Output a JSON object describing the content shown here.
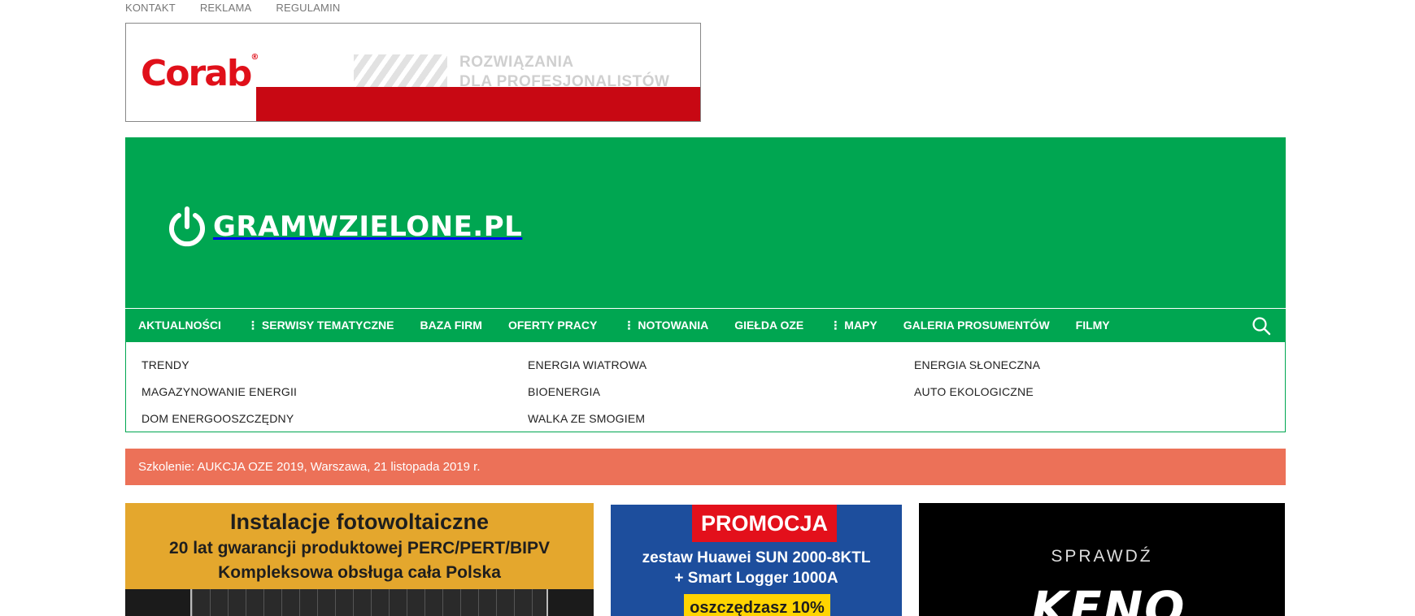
{
  "top_links": [
    "KONTAKT",
    "REKLAMA",
    "REGULAMIN"
  ],
  "ad_banner": {
    "logo_text": "Corab",
    "logo_mark": "®",
    "slogan_line1": "ROZWIĄZANIA",
    "slogan_line2": "DLA PROFESJONALISTÓW",
    "brand_color": "#c80813"
  },
  "header": {
    "site_name": "GRAMWZIELONE.PL",
    "logo_icon": "power-icon",
    "brand_color": "#00a651"
  },
  "nav": {
    "items": [
      {
        "label": "AKTUALNOŚCI",
        "has_submenu": false
      },
      {
        "label": "SERWISY TEMATYCZNE",
        "has_submenu": true
      },
      {
        "label": "BAZA FIRM",
        "has_submenu": false
      },
      {
        "label": "OFERTY PRACY",
        "has_submenu": false
      },
      {
        "label": "NOTOWANIA",
        "has_submenu": true
      },
      {
        "label": "GIEŁDA OZE",
        "has_submenu": false
      },
      {
        "label": "MAPY",
        "has_submenu": true
      },
      {
        "label": "GALERIA PROSUMENTÓW",
        "has_submenu": false
      },
      {
        "label": "FILMY",
        "has_submenu": false
      }
    ],
    "submenu_marker": "⋮",
    "search_icon": "search-icon"
  },
  "submenu": {
    "col1": [
      "TRENDY",
      "MAGAZYNOWANIE ENERGII",
      "DOM ENERGOOSZCZĘDNY"
    ],
    "col2": [
      "ENERGIA WIATROWA",
      "BIOENERGIA",
      "WALKA ZE SMOGIEM"
    ],
    "col3": [
      "ENERGIA SŁONECZNA",
      "AUTO EKOLOGICZNE"
    ]
  },
  "alert": {
    "text": "Szkolenie: AUKCJA OZE 2019, Warszawa, 21 listopada 2019 r.",
    "color": "#ec7158"
  },
  "ads": {
    "solar": {
      "line1": "Instalacje fotowoltaiczne",
      "line2": "20 lat gwarancji produktowej PERC/PERT/BIPV",
      "line3": "Kompleksowa obsługa cała Polska"
    },
    "huawei": {
      "promo": "PROMOCJA",
      "line1": "zestaw Huawei SUN 2000-8KTL",
      "line2": "+ Smart Logger 1000A",
      "save": "oszczędzasz 10%"
    },
    "keno": {
      "check": "SPRAWDŹ",
      "brand": "KENO"
    }
  }
}
